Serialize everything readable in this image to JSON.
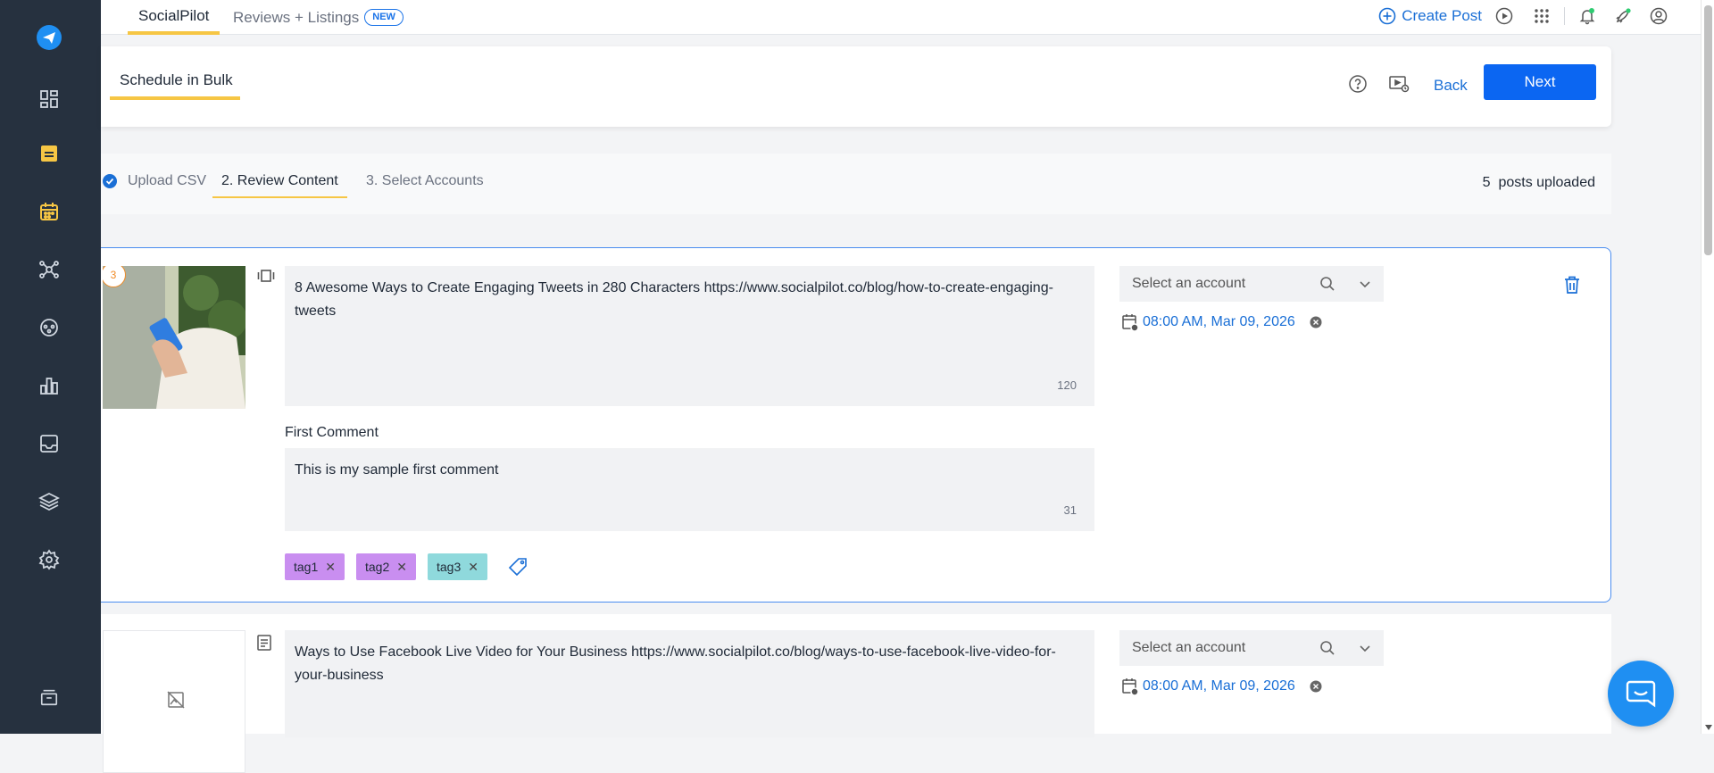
{
  "sidebar": {
    "items": [
      {
        "icon": "paper-plane-logo-icon",
        "active": true
      },
      {
        "icon": "dashboard-icon"
      },
      {
        "icon": "posts-icon",
        "highlighted": true
      },
      {
        "icon": "calendar-icon",
        "highlighted": true
      },
      {
        "icon": "network-icon"
      },
      {
        "icon": "engage-icon"
      },
      {
        "icon": "analytics-icon"
      },
      {
        "icon": "inbox-icon"
      },
      {
        "icon": "layers-icon"
      },
      {
        "icon": "settings-icon"
      },
      {
        "icon": "archive-icon"
      }
    ]
  },
  "topbar": {
    "tabs": [
      {
        "label": "SocialPilot",
        "active": true
      },
      {
        "label": "Reviews + Listings",
        "badge": "NEW"
      }
    ],
    "create_post_label": "Create Post",
    "icons": [
      "play-icon",
      "apps-grid-icon",
      "bell-icon",
      "rocket-icon",
      "user-icon"
    ]
  },
  "header": {
    "title": "Schedule in Bulk",
    "back_label": "Back",
    "next_label": "Next"
  },
  "steps": {
    "items": [
      {
        "label": "Upload CSV",
        "state": "done"
      },
      {
        "label": "2. Review Content",
        "state": "active"
      },
      {
        "label": "3. Select Accounts",
        "state": "pending"
      }
    ],
    "posts_count": "5",
    "posts_count_suffix": "posts uploaded"
  },
  "posts": [
    {
      "index": "3",
      "media_type": "carousel-icon",
      "text": "8 Awesome Ways to Create Engaging Tweets in 280 Characters https://www.socialpilot.co/blog/how-to-create-engaging-tweets",
      "char_count": "120",
      "first_comment_label": "First Comment",
      "first_comment": "This is my sample first comment",
      "first_comment_count": "31",
      "tags": [
        {
          "label": "tag1",
          "color": "#c98ef0"
        },
        {
          "label": "tag2",
          "color": "#c98ef0"
        },
        {
          "label": "tag3",
          "color": "#8fd9dc"
        }
      ],
      "account_placeholder": "Select an account",
      "schedule": "08:00 AM, Mar 09, 2026"
    },
    {
      "media_type": "text-post-icon",
      "text": "Ways to Use Facebook Live Video for Your Business https://www.socialpilot.co/blog/ways-to-use-facebook-live-video-for-your-business",
      "account_placeholder": "Select an account",
      "schedule": "08:00 AM, Mar 09, 2026"
    }
  ],
  "colors": {
    "sidebar": "#26313f",
    "accent_yellow": "#f6c644",
    "primary": "#0b66f2",
    "link": "#1a6fd6"
  }
}
